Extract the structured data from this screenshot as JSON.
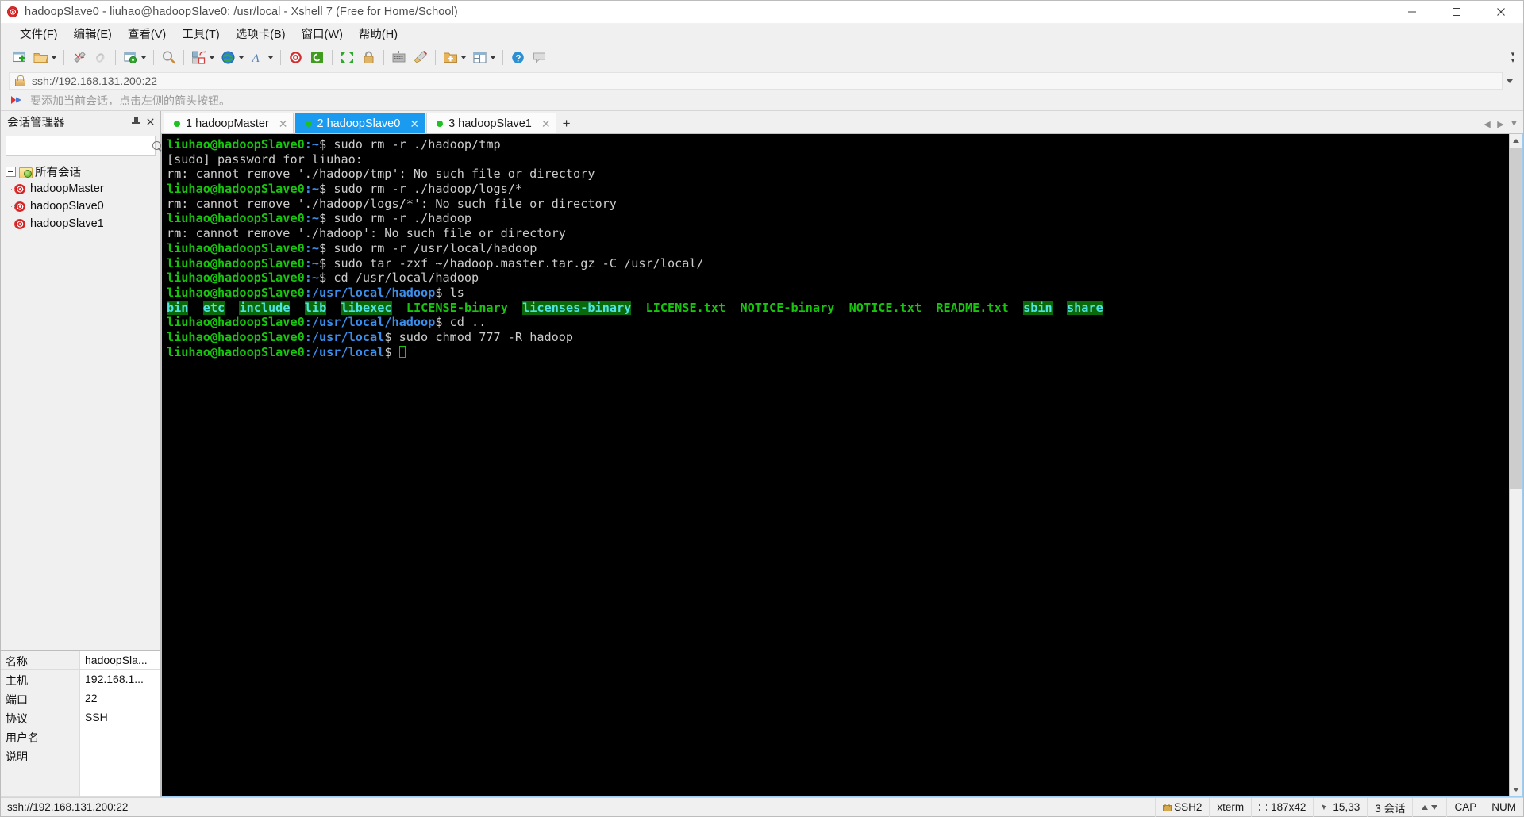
{
  "window": {
    "title": "hadoopSlave0 - liuhao@hadoopSlave0: /usr/local - Xshell 7 (Free for Home/School)",
    "app_icon": "snail-icon",
    "minimize_label": "–",
    "maximize_label": "□",
    "close_label": "✕"
  },
  "menubar": {
    "items": [
      {
        "label": "文件(F)",
        "name": "menu-file"
      },
      {
        "label": "编辑(E)",
        "name": "menu-edit"
      },
      {
        "label": "查看(V)",
        "name": "menu-view"
      },
      {
        "label": "工具(T)",
        "name": "menu-tools"
      },
      {
        "label": "选项卡(B)",
        "name": "menu-tabs"
      },
      {
        "label": "窗口(W)",
        "name": "menu-window"
      },
      {
        "label": "帮助(H)",
        "name": "menu-help"
      }
    ]
  },
  "toolbar": {
    "items": [
      {
        "name": "new-session-icon",
        "icon": "new-session-icon",
        "caret": false
      },
      {
        "name": "open-session-icon",
        "icon": "open-folder-icon",
        "caret": true
      },
      {
        "sep": true
      },
      {
        "name": "disconnect-icon",
        "icon": "disconnect-icon",
        "caret": false
      },
      {
        "name": "reconnect-icon",
        "icon": "link-icon",
        "caret": false
      },
      {
        "sep": true
      },
      {
        "name": "session-properties-icon",
        "icon": "properties-gear-icon",
        "caret": true
      },
      {
        "sep": true
      },
      {
        "name": "find-icon",
        "icon": "magnifier-icon",
        "caret": false
      },
      {
        "sep": true
      },
      {
        "name": "layout-icon",
        "icon": "layout-icon",
        "caret": true
      },
      {
        "name": "globe-icon",
        "icon": "globe-icon",
        "caret": true
      },
      {
        "name": "font-icon",
        "icon": "font-a-icon",
        "caret": true
      },
      {
        "sep": true
      },
      {
        "name": "xshell-icon",
        "icon": "snail-red-icon",
        "caret": false
      },
      {
        "name": "xftp-icon",
        "icon": "xftp-green-icon",
        "caret": false
      },
      {
        "sep": true
      },
      {
        "name": "fullscreen-icon",
        "icon": "fullscreen-arrows-icon",
        "caret": false
      },
      {
        "name": "lock-icon",
        "icon": "padlock-icon",
        "caret": false
      },
      {
        "sep": true
      },
      {
        "name": "keyboard-icon",
        "icon": "keyboard-icon",
        "caret": false
      },
      {
        "name": "highlight-icon",
        "icon": "highlighter-pen-icon",
        "caret": false
      },
      {
        "sep": true
      },
      {
        "name": "add-to-folder-icon",
        "icon": "folder-plus-icon",
        "caret": true
      },
      {
        "name": "split-view-icon",
        "icon": "split-window-icon",
        "caret": true
      },
      {
        "sep": true
      },
      {
        "name": "help-icon",
        "icon": "help-question-icon",
        "caret": false
      },
      {
        "name": "chat-icon",
        "icon": "chat-bubble-icon",
        "caret": false
      }
    ],
    "overflow_label": "»"
  },
  "address_bar": {
    "lock_icon": "lock-icon",
    "value": "ssh://192.168.131.200:22",
    "placeholder": "ssh://192.168.131.200:22",
    "dropdown_icon": "chevron-down-icon"
  },
  "notice_bar": {
    "icon": "arrow-flag-icon",
    "text": "要添加当前会话，点击左侧的箭头按钮。"
  },
  "session_manager": {
    "title": "会话管理器",
    "pin_icon": "pin-icon",
    "close_icon": "close-icon",
    "search": {
      "value": "",
      "placeholder": ""
    },
    "root": {
      "label": "所有会话",
      "icon": "folder-sessions-icon"
    },
    "sessions": [
      {
        "label": "hadoopMaster",
        "icon": "snail-icon"
      },
      {
        "label": "hadoopSlave0",
        "icon": "snail-icon"
      },
      {
        "label": "hadoopSlave1",
        "icon": "snail-icon"
      }
    ],
    "properties": [
      {
        "key": "名称",
        "value": "hadoopSla..."
      },
      {
        "key": "主机",
        "value": "192.168.1..."
      },
      {
        "key": "端口",
        "value": "22"
      },
      {
        "key": "协议",
        "value": "SSH"
      },
      {
        "key": "用户名",
        "value": ""
      },
      {
        "key": "说明",
        "value": ""
      }
    ]
  },
  "tabs": {
    "items": [
      {
        "num": "1",
        "label": "hadoopMaster",
        "active": false,
        "status": "connected"
      },
      {
        "num": "2",
        "label": "hadoopSlave0",
        "active": true,
        "status": "connected"
      },
      {
        "num": "3",
        "label": "hadoopSlave1",
        "active": false,
        "status": "connected"
      }
    ],
    "add_label": "+",
    "scroll_left_icon": "chevron-left-icon",
    "scroll_right_icon": "chevron-right-icon",
    "list_icon": "chevron-down-icon"
  },
  "terminal": {
    "prompt_home": "liuhao@hadoopSlave0:~$",
    "prompt_hadoop": "liuhao@hadoopSlave0:/usr/local/hadoop$",
    "prompt_local": "liuhao@hadoopSlave0:/usr/local$",
    "lines": [
      {
        "type": "prompt",
        "prompt": "home",
        "cmd": " sudo rm -r ./hadoop/tmp"
      },
      {
        "type": "out",
        "text": "[sudo] password for liuhao:"
      },
      {
        "type": "out",
        "text": "rm: cannot remove './hadoop/tmp': No such file or directory"
      },
      {
        "type": "prompt",
        "prompt": "home",
        "cmd": " sudo rm -r ./hadoop/logs/*"
      },
      {
        "type": "out",
        "text": "rm: cannot remove './hadoop/logs/*': No such file or directory"
      },
      {
        "type": "prompt",
        "prompt": "home",
        "cmd": " sudo rm -r ./hadoop"
      },
      {
        "type": "out",
        "text": "rm: cannot remove './hadoop': No such file or directory"
      },
      {
        "type": "prompt",
        "prompt": "home",
        "cmd": " sudo rm -r /usr/local/hadoop"
      },
      {
        "type": "prompt",
        "prompt": "home",
        "cmd": " sudo tar -zxf ~/hadoop.master.tar.gz -C /usr/local/"
      },
      {
        "type": "prompt",
        "prompt": "home",
        "cmd": " cd /usr/local/hadoop"
      },
      {
        "type": "prompt",
        "prompt": "hadoop",
        "cmd": " ls"
      },
      {
        "type": "ls"
      },
      {
        "type": "prompt",
        "prompt": "hadoop",
        "cmd": " cd .."
      },
      {
        "type": "prompt",
        "prompt": "local",
        "cmd": " sudo chmod 777 -R hadoop"
      },
      {
        "type": "prompt",
        "prompt": "local",
        "cmd": " ",
        "cursor": true
      }
    ],
    "ls_entries": [
      {
        "name": "bin",
        "kind": "dir"
      },
      {
        "name": "etc",
        "kind": "dir"
      },
      {
        "name": "include",
        "kind": "dir"
      },
      {
        "name": "lib",
        "kind": "dir"
      },
      {
        "name": "libexec",
        "kind": "dir"
      },
      {
        "name": "LICENSE-binary",
        "kind": "file"
      },
      {
        "name": "licenses-binary",
        "kind": "dir"
      },
      {
        "name": "LICENSE.txt",
        "kind": "file"
      },
      {
        "name": "NOTICE-binary",
        "kind": "file"
      },
      {
        "name": "NOTICE.txt",
        "kind": "file"
      },
      {
        "name": "README.txt",
        "kind": "file"
      },
      {
        "name": "sbin",
        "kind": "dir"
      },
      {
        "name": "share",
        "kind": "dir"
      }
    ],
    "colors": {
      "background": "#000000",
      "foreground": "#cccccc",
      "green": "#16c60c",
      "blue": "#3b8eea",
      "dir_fg": "#4fe3e3",
      "dir_bg": "#0a6a0a"
    }
  },
  "statusbar": {
    "left": "ssh://192.168.131.200:22",
    "cells": [
      {
        "name": "ssh-version",
        "icon": "lock-icon",
        "text": "SSH2"
      },
      {
        "name": "term-type",
        "icon": "",
        "text": "xterm"
      },
      {
        "name": "term-size",
        "icon": "size-icon",
        "text": "187x42"
      },
      {
        "name": "cursor-pos",
        "icon": "pos-icon",
        "text": "15,33"
      },
      {
        "name": "session-count",
        "icon": "",
        "text": "3 会话"
      },
      {
        "name": "transfer-indicator",
        "icon": "up-down-arrows-icon",
        "text": ""
      },
      {
        "name": "caps-indicator",
        "icon": "",
        "text": "CAP"
      },
      {
        "name": "num-indicator",
        "icon": "",
        "text": "NUM"
      }
    ]
  }
}
